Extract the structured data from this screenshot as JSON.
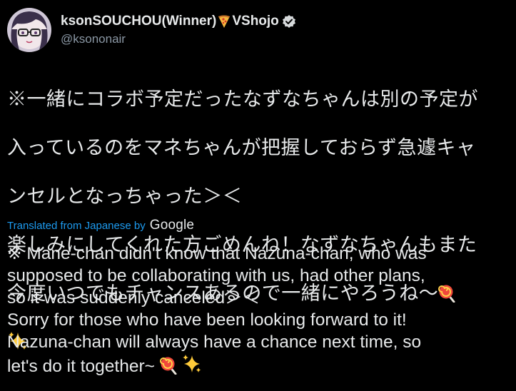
{
  "user": {
    "display_name": "ksonSOUCHOU(Winner)",
    "display_name_suffix": "VShojo",
    "handle": "@ksononair"
  },
  "original_text": {
    "lines": [
      "※一緒にコラボ予定だったなずなちゃんは別の予定が",
      "入っているのをマネちゃんが把握しておらず急遽キャ",
      "ンセルとなっちゃった＞＜",
      "楽しみにしてくれた方ごめんね！なずなちゃんもまた",
      "今度いつでもチャンスあるので一緒にやろうね〜"
    ]
  },
  "translation": {
    "label": "Translated from Japanese by",
    "provider": "Google",
    "lines": [
      "※ Mane-chan didn't know that Nazuna-chan, who was",
      "supposed to be collaborating with us, had other plans,",
      "so it was suddenly canceled＞＜",
      "Sorry for those who have been looking forward to it!",
      "Nazuna-chan will always have a chance next time, so",
      "let's do it together~"
    ]
  },
  "icons": {
    "pizza": "pizza-icon",
    "verified": "verified-badge-icon",
    "lollipop": "lollipop-emoji",
    "sparkles": "sparkles-emoji"
  },
  "colors": {
    "background": "#000000",
    "text": "#e7e9ea",
    "muted": "#8b98a5",
    "link": "#1d9bf0"
  }
}
